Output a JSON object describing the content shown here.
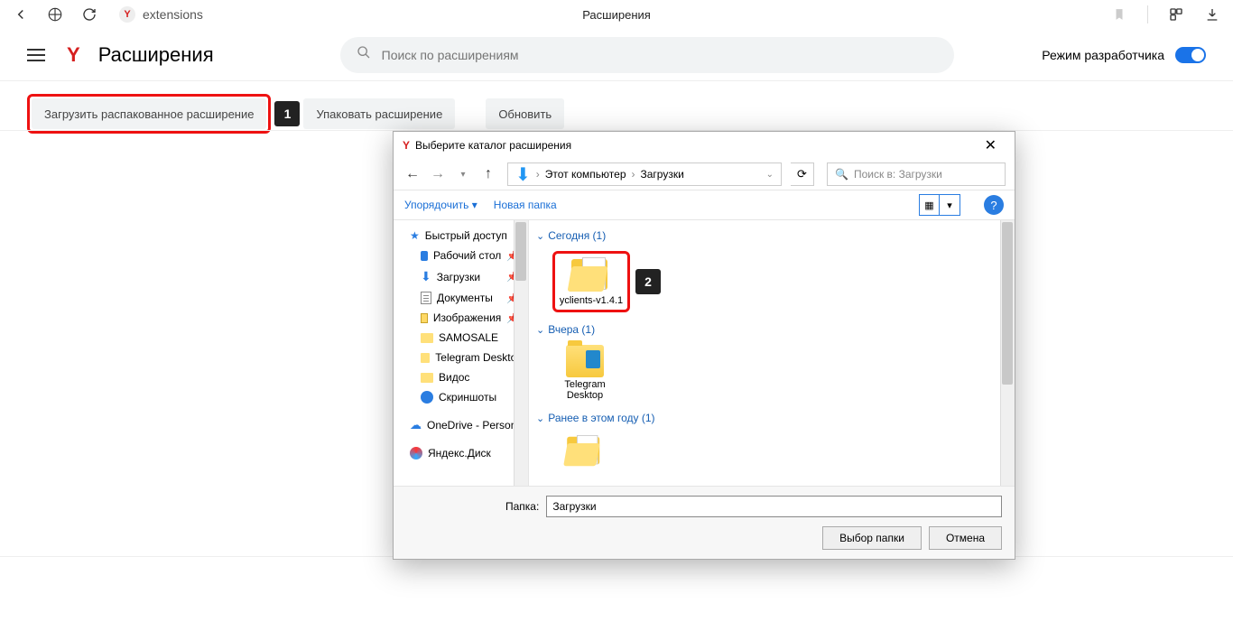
{
  "chrome": {
    "url": "extensions",
    "tab_title": "Расширения"
  },
  "page": {
    "title": "Расширения",
    "search_placeholder": "Поиск по расширениям",
    "dev_mode_label": "Режим разработчика",
    "buttons": {
      "load_unpacked": "Загрузить распакованное расширение",
      "pack": "Упаковать расширение",
      "update": "Обновить"
    },
    "callout1": "1",
    "callout2": "2"
  },
  "dialog": {
    "title": "Выберите каталог расширения",
    "crumb1": "Этот компьютер",
    "crumb2": "Загрузки",
    "search_placeholder": "Поиск в: Загрузки",
    "toolbar": {
      "organize": "Упорядочить",
      "new_folder": "Новая папка"
    },
    "nav": {
      "quick_access": "Быстрый доступ",
      "desktop": "Рабочий стол",
      "downloads": "Загрузки",
      "documents": "Документы",
      "pictures": "Изображения",
      "samosale": "SAMOSALE",
      "telegram": "Telegram Desktop",
      "videos": "Видос",
      "screenshots": "Скриншоты",
      "onedrive": "OneDrive - Personal",
      "yadisk": "Яндекс.Диск"
    },
    "groups": {
      "today": "Сегодня (1)",
      "yesterday": "Вчера (1)",
      "earlier": "Ранее в этом году (1)"
    },
    "items": {
      "yclients": "yclients-v1.4.1",
      "telegram": "Telegram Desktop"
    },
    "footer": {
      "label": "Папка:",
      "value": "Загрузки",
      "select": "Выбор папки",
      "cancel": "Отмена"
    }
  }
}
